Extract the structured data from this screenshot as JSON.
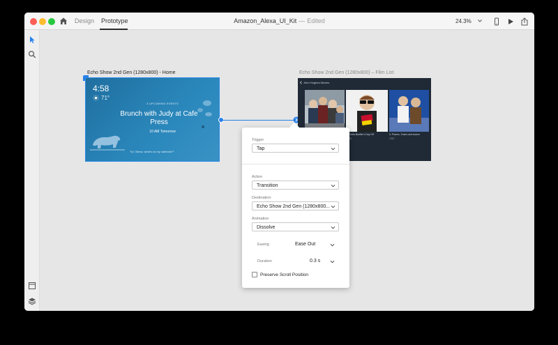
{
  "titlebar": {
    "tabs": [
      "Design",
      "Prototype"
    ],
    "active_tab": "Prototype",
    "document_name": "Amazon_Alexa_UI_Kit",
    "separator": "—",
    "status": "Edited",
    "zoom": "24.3%"
  },
  "colors": {
    "accent": "#2680eb",
    "close": "#fd5f57",
    "minimize": "#fdbc2e",
    "maximize": "#28c840"
  },
  "artboards": {
    "home": {
      "label": "Echo Show 2nd Gen (1280x800) - Home",
      "time": "4:58",
      "temp": "71°",
      "events": "3 UPCOMING EVENTS",
      "headline": "Brunch with Judy at Cafe Press",
      "when": "10 AM Tomorrow",
      "hint": "Try \"Alexa, what's on my calendar?\""
    },
    "film": {
      "label": "Echo Show 2nd Gen (1280x800) – Film List",
      "header": "John Hughes Movies",
      "captions": [
        "",
        "2. Ferris Bueller's Day Off",
        "3. Planes, Trains and Autom"
      ],
      "years": [
        "",
        "1986",
        "1987"
      ]
    }
  },
  "popover": {
    "trigger_label": "Trigger",
    "trigger_value": "Tap",
    "action_label": "Action",
    "action_value": "Transition",
    "destination_label": "Destination",
    "destination_value": "Echo Show 2nd Gen (1280x800...",
    "animation_label": "Animation",
    "animation_value": "Dissolve",
    "easing_label": "Easing",
    "easing_value": "Ease Out",
    "duration_label": "Duration",
    "duration_value": "0.3 s",
    "preserve_label": "Preserve Scroll Position",
    "preserve_checked": false
  }
}
